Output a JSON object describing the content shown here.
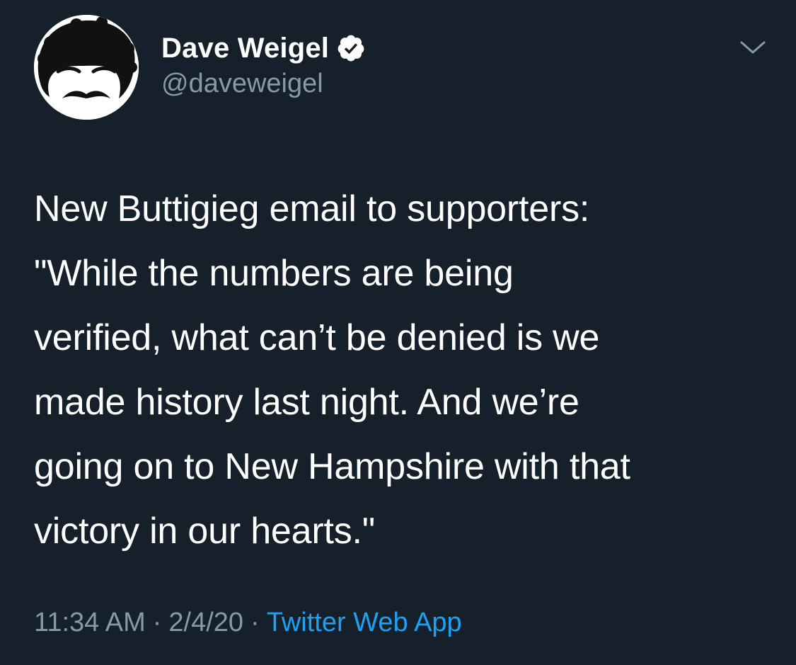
{
  "tweet": {
    "author": {
      "display_name": "Dave Weigel",
      "handle": "@daveweigel",
      "verified": true,
      "verified_icon": "verified-badge-icon",
      "avatar_icon": "caricature-avatar"
    },
    "menu_icon": "chevron-down-icon",
    "text": "New Buttigieg email to supporters:\n\"While the numbers are being\nverified, what can’t be denied is we\nmade history last night. And we’re\ngoing on to New Hampshire with that\nvictory in our hearts.\"",
    "time": "11:34 AM",
    "date": "2/4/20",
    "separator": "·",
    "source": "Twitter Web App"
  },
  "colors": {
    "background": "#15202b",
    "text": "#ffffff",
    "secondary": "#8899a6",
    "link": "#1da1f2"
  }
}
